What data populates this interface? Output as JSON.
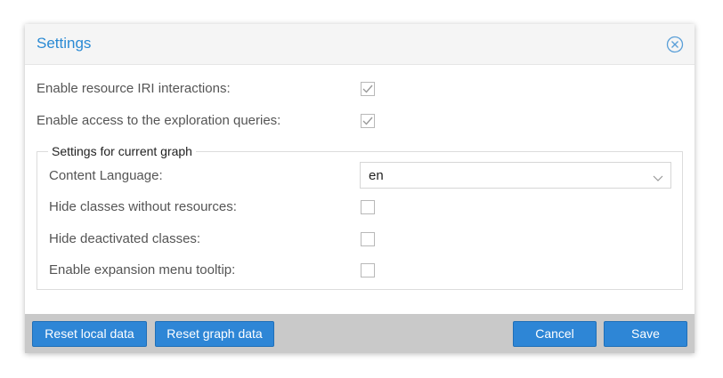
{
  "dialog": {
    "title": "Settings",
    "close_icon": "close-circle-icon"
  },
  "general": {
    "iri_interactions_label": "Enable resource IRI interactions:",
    "iri_interactions_checked": true,
    "exploration_queries_label": "Enable access to the exploration queries:",
    "exploration_queries_checked": true
  },
  "graph_settings": {
    "legend": "Settings for current graph",
    "content_language_label": "Content Language:",
    "content_language_value": "en",
    "hide_classes_label": "Hide classes without resources:",
    "hide_classes_checked": false,
    "hide_deactivated_label": "Hide deactivated classes:",
    "hide_deactivated_checked": false,
    "expansion_tooltip_label": "Enable expansion menu tooltip:",
    "expansion_tooltip_checked": false
  },
  "footer": {
    "reset_local_label": "Reset local data",
    "reset_graph_label": "Reset graph data",
    "cancel_label": "Cancel",
    "save_label": "Save"
  },
  "colors": {
    "accent": "#2a8ad4",
    "button": "#2e86d6",
    "footer_bg": "#c9c9c9"
  }
}
